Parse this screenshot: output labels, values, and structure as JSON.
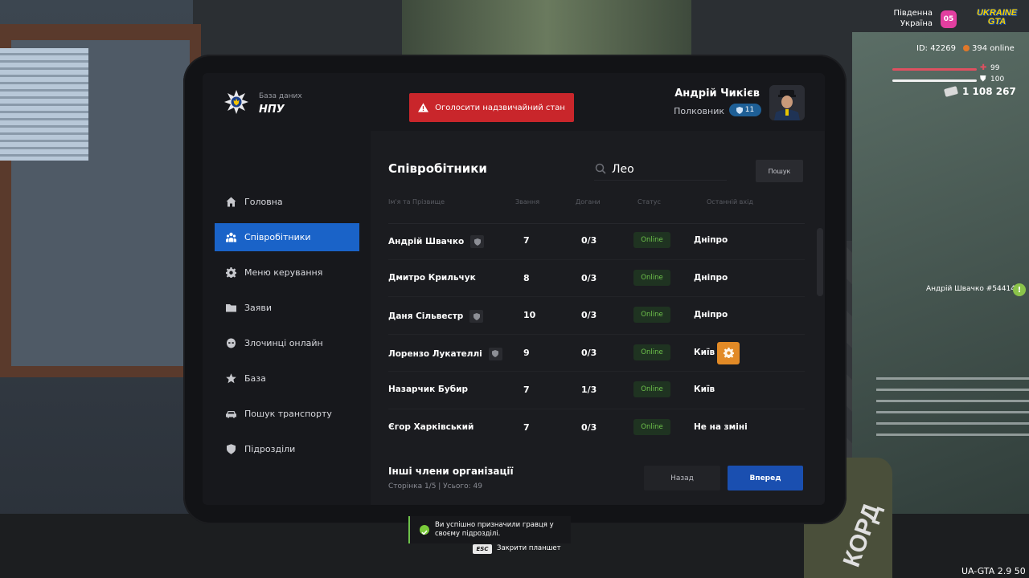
{
  "hud": {
    "region_line1": "Південна",
    "region_line2": "Україна",
    "server_badge": "05",
    "logo_line1": "UKRAINE",
    "logo_line2": "GTA",
    "player_id": "ID: 42269",
    "online": "394 online",
    "health": "99",
    "armor": "100",
    "money": "1 108 267",
    "nearby_player": "Андрій Швачко #54414",
    "version": "UA-GTA 2.9  50"
  },
  "header": {
    "brand_subtitle": "База даних",
    "brand_title": "НПУ",
    "emergency_button": "Оголосити надзвичайний стан",
    "user_name": "Андрій Чикієв",
    "user_rank": "Полковник",
    "user_level": "11"
  },
  "sidebar": {
    "items": [
      {
        "label": "Головна",
        "icon": "home-icon"
      },
      {
        "label": "Співробітники",
        "icon": "users-icon",
        "active": true
      },
      {
        "label": "Меню керування",
        "icon": "gear-icon"
      },
      {
        "label": "Заяви",
        "icon": "folder-icon"
      },
      {
        "label": "Злочинці онлайн",
        "icon": "mask-icon"
      },
      {
        "label": "База",
        "icon": "star-icon"
      },
      {
        "label": "Пошук транспорту",
        "icon": "car-icon"
      },
      {
        "label": "Підрозділи",
        "icon": "shield-icon"
      }
    ]
  },
  "employees": {
    "title": "Співробітники",
    "search_value": "Лео",
    "search_button": "Пошук",
    "columns": [
      "Ім'я та Прізвище",
      "Звання",
      "Догани",
      "Статус",
      "Останній вхід"
    ],
    "rows": [
      {
        "name": "Андрій Швачко",
        "badge": true,
        "rank": "7",
        "warnings": "0/3",
        "status": "Online",
        "last_login": "Дніпро"
      },
      {
        "name": "Дмитро Крильчук",
        "badge": false,
        "rank": "8",
        "warnings": "0/3",
        "status": "Online",
        "last_login": "Дніпро"
      },
      {
        "name": "Даня Сільвестр",
        "badge": true,
        "rank": "10",
        "warnings": "0/3",
        "status": "Online",
        "last_login": "Дніпро"
      },
      {
        "name": "Лорензо Лукателлі",
        "badge": true,
        "rank": "9",
        "warnings": "0/3",
        "status": "Online",
        "last_login": "Київ",
        "gear": true
      },
      {
        "name": "Назарчик Бубир",
        "badge": false,
        "rank": "7",
        "warnings": "1/3",
        "status": "Online",
        "last_login": "Київ"
      },
      {
        "name": "Єгор Харківський",
        "badge": false,
        "rank": "7",
        "warnings": "0/3",
        "status": "Online",
        "last_login": "Не на зміні"
      }
    ],
    "others_title": "Інші члени організації",
    "pager_info": "Сторінка 1/5 | Усього: 49",
    "back_button": "Назад",
    "next_button": "Вперед"
  },
  "notification": {
    "text": "Ви успішно призначили гравця у своєму підрозділі.",
    "esc_key": "ESC",
    "esc_text": "Закрити планшет"
  },
  "colors": {
    "accent_blue": "#1a63c8",
    "emergency_red": "#c9262b",
    "online_green": "#6ec24b",
    "gear_orange": "#e28a26"
  }
}
